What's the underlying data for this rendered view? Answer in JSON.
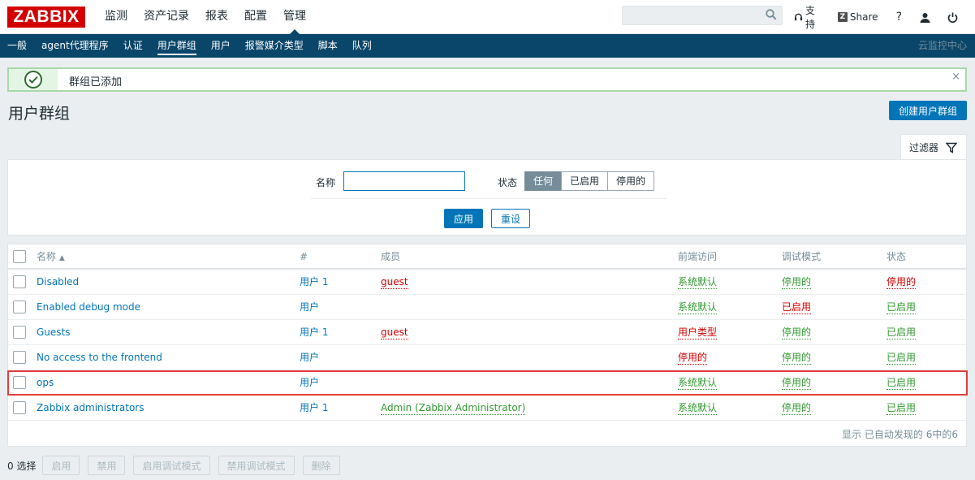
{
  "app": {
    "logo": "ZABBIX"
  },
  "main_menu": [
    {
      "label": "监测"
    },
    {
      "label": "资产记录"
    },
    {
      "label": "报表"
    },
    {
      "label": "配置"
    },
    {
      "label": "管理",
      "active": true
    }
  ],
  "search": {
    "placeholder": ""
  },
  "top_right": {
    "support": "支持",
    "share": "Share",
    "help": "?"
  },
  "sub_menu": [
    {
      "label": "一般"
    },
    {
      "label": "agent代理程序"
    },
    {
      "label": "认证"
    },
    {
      "label": "用户群组",
      "active": true
    },
    {
      "label": "用户"
    },
    {
      "label": "报警媒介类型"
    },
    {
      "label": "脚本"
    },
    {
      "label": "队列"
    }
  ],
  "cloud_label": "云监控中心",
  "message": {
    "text": "群组已添加"
  },
  "page": {
    "title": "用户群组",
    "create_button": "创建用户群组"
  },
  "filter": {
    "tab_label": "过滤器",
    "name_label": "名称",
    "name_value": "",
    "status_label": "状态",
    "status_options": [
      "任何",
      "已启用",
      "停用的"
    ],
    "status_selected": "任何",
    "apply": "应用",
    "reset": "重设"
  },
  "table": {
    "columns": [
      "名称",
      "#",
      "成员",
      "前端访问",
      "调试模式",
      "状态"
    ],
    "sort_indicator": "▲",
    "rows": [
      {
        "name": "Disabled",
        "count": "用户 1",
        "members": "guest",
        "members_color": "red",
        "frontend": "系统默认",
        "frontend_color": "green",
        "debug": "停用的",
        "debug_color": "green",
        "status": "停用的",
        "status_color": "red"
      },
      {
        "name": "Enabled debug mode",
        "count": "用户",
        "members": "",
        "members_color": "",
        "frontend": "系统默认",
        "frontend_color": "green",
        "debug": "已启用",
        "debug_color": "red",
        "status": "已启用",
        "status_color": "green"
      },
      {
        "name": "Guests",
        "count": "用户 1",
        "members": "guest",
        "members_color": "red",
        "frontend": "用户类型",
        "frontend_color": "red",
        "debug": "停用的",
        "debug_color": "green",
        "status": "已启用",
        "status_color": "green"
      },
      {
        "name": "No access to the frontend",
        "count": "用户",
        "members": "",
        "members_color": "",
        "frontend": "停用的",
        "frontend_color": "red",
        "debug": "停用的",
        "debug_color": "green",
        "status": "已启用",
        "status_color": "green"
      },
      {
        "name": "ops",
        "count": "用户",
        "members": "",
        "members_color": "",
        "frontend": "系统默认",
        "frontend_color": "green",
        "debug": "停用的",
        "debug_color": "green",
        "status": "已启用",
        "status_color": "green"
      },
      {
        "name": "Zabbix administrators",
        "count": "用户 1",
        "members": "Admin (Zabbix Administrator)",
        "members_color": "green",
        "frontend": "系统默认",
        "frontend_color": "green",
        "debug": "停用的",
        "debug_color": "green",
        "status": "已启用",
        "status_color": "green"
      }
    ],
    "footer": "显示 已自动发现的 6中的6"
  },
  "bottom_actions": {
    "selected_count": "0 选择",
    "buttons": [
      "启用",
      "禁用",
      "启用调试模式",
      "禁用调试模式",
      "删除"
    ]
  },
  "colors": {
    "accent": "#0275b8",
    "nav": "#0a466a",
    "red": "#d40000",
    "green": "#339933",
    "highlight": "#e63c3c"
  }
}
